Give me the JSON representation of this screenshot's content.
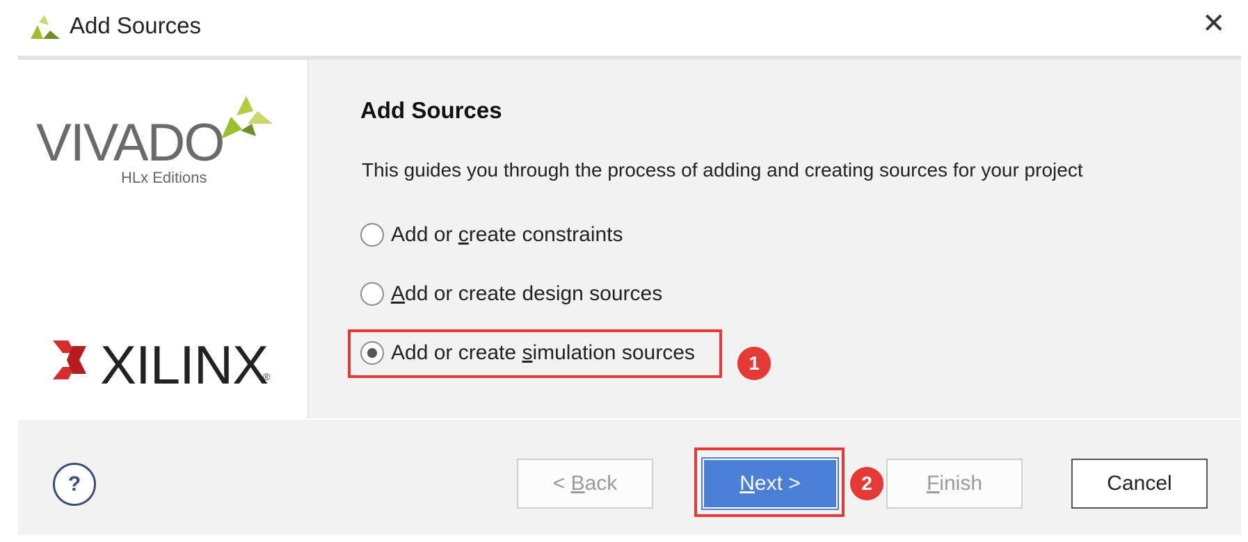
{
  "window": {
    "title": "Add Sources",
    "close_label": "✕"
  },
  "branding": {
    "vivado_word": "VIVADO",
    "vivado_sub": "HLx Editions",
    "xilinx_word": "XILINX",
    "xilinx_reg": "®",
    "accent_green": "#9bbf2a",
    "xilinx_red": "#d32f2f"
  },
  "page": {
    "heading": "Add Sources",
    "description": "This guides you through the process of adding and creating sources for your project"
  },
  "options": [
    {
      "pre": "Add or ",
      "u": "c",
      "post": "reate constraints",
      "checked": false
    },
    {
      "pre": "",
      "u": "A",
      "post": "dd or create design sources",
      "checked": false
    },
    {
      "pre": "Add or create ",
      "u": "s",
      "post": "imulation sources",
      "checked": true
    }
  ],
  "annotations": {
    "badge_1": "1",
    "badge_2": "2",
    "color": "#e53935"
  },
  "footer": {
    "help_label": "?",
    "back": {
      "pre": "< ",
      "u": "B",
      "post": "ack"
    },
    "next": {
      "pre": "",
      "u": "N",
      "post": "ext >"
    },
    "finish": {
      "pre": "",
      "u": "F",
      "post": "inish"
    },
    "cancel": "Cancel"
  }
}
